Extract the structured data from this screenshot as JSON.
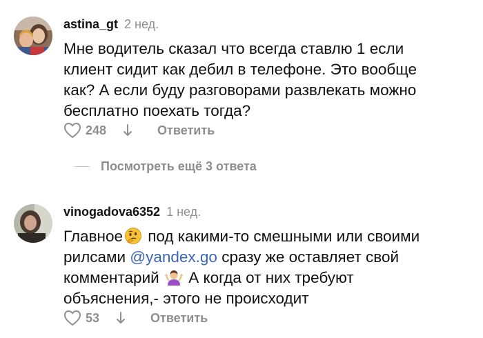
{
  "comments": [
    {
      "username": "astina_gt",
      "time": "2 нед.",
      "lines": [
        "Мне водитель сказал что всегда ставлю 1 если",
        "клиент сидит как дебил в телефоне. Это вообще",
        "как? А если буду разговорами развлекать можно",
        "бесплатно поехать тогда?"
      ],
      "likes": "248",
      "reply_label": "Ответить",
      "icons": {
        "avatar": "avatar-photo-icon",
        "like": "heart-outline-icon",
        "dislike": "arrow-down-icon"
      }
    },
    {
      "username": "vinogadova6352",
      "time": "1 нед.",
      "line1_text": "Главное",
      "line1_rest": " под какими-то смешными или своими",
      "line2_pre": "рилсами ",
      "mention": "@yandex.go",
      "line2_post": "  сразу же оставляет свой",
      "line3_pre": "комментарий ",
      "line3_post": " А когда от них требуют",
      "line4": "объяснения,- этого не происходит",
      "likes": "53",
      "reply_label": "Ответить",
      "icons": {
        "avatar": "avatar-photo-icon",
        "thinking": "thinking-face-emoji",
        "shrug": "person-shrugging-emoji",
        "like": "heart-outline-icon",
        "dislike": "arrow-down-icon"
      }
    }
  ],
  "more_replies_label": "Посмотреть ещё 3 ответа",
  "colors": {
    "text": "#111111",
    "secondary": "#8e8e8e",
    "mention": "#3a66b8"
  }
}
